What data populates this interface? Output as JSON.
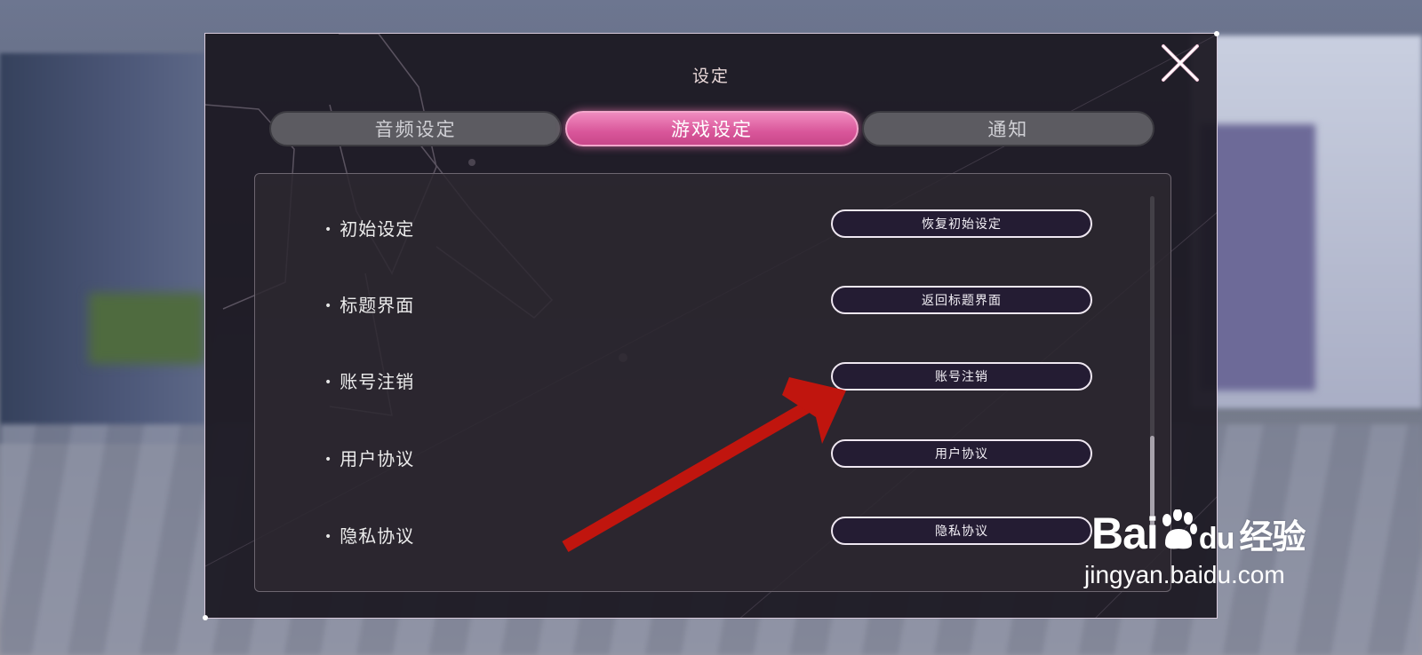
{
  "window": {
    "title": "设定"
  },
  "tabs": [
    {
      "label": "音频设定",
      "active": false
    },
    {
      "label": "游戏设定",
      "active": true
    },
    {
      "label": "通知",
      "active": false
    }
  ],
  "settings": [
    {
      "label": "初始设定",
      "button": "恢复初始设定"
    },
    {
      "label": "标题界面",
      "button": "返回标题界面"
    },
    {
      "label": "账号注销",
      "button": "账号注销"
    },
    {
      "label": "用户协议",
      "button": "用户协议"
    },
    {
      "label": "隐私协议",
      "button": "隐私协议"
    }
  ],
  "icons": {
    "close": "close-icon",
    "arrow": "arrow-annotation"
  },
  "watermark": {
    "brand_latin": "Bai",
    "brand_du": "du",
    "brand_cn": "经验",
    "url": "jingyan.baidu.com"
  },
  "colors": {
    "accent": "#d9569a",
    "annotation_arrow": "#c0150e",
    "panel": "#1c1822"
  }
}
